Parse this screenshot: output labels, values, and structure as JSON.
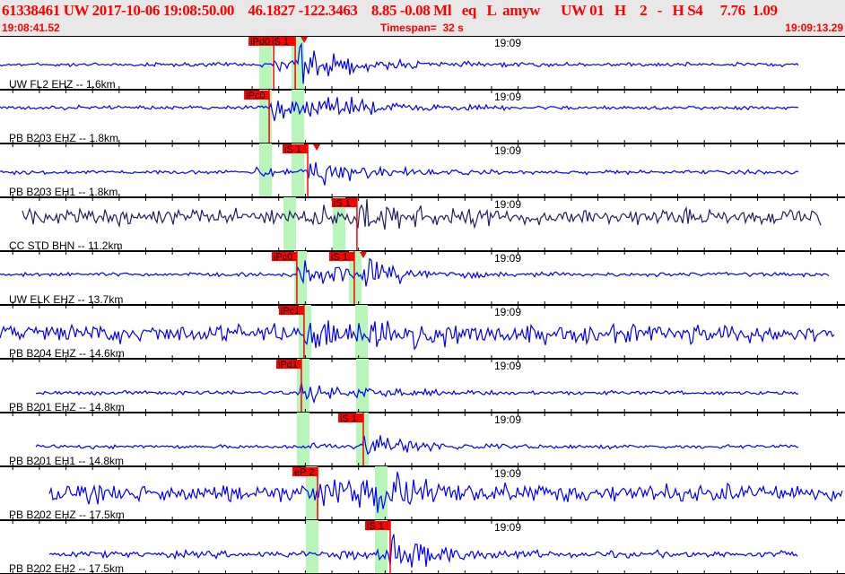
{
  "header": {
    "title": "61338461 UW 2017-10-06 19:08:50.00    46.1827 -122.3463    8.85 -0.08 Ml   eq   L  amyw      UW 01   H    2   -   H S4     7.76  1.09",
    "start_time": "19:08:41.52",
    "timespan_label": "Timespan=",
    "timespan_value": "32 s",
    "end_time": "19:09:13.29"
  },
  "colors": {
    "trace": "#0000ff",
    "trace_broadband": "#202060",
    "pick": "#ff0000",
    "window": "#b8f5b8",
    "header_text": "#ff0000"
  },
  "minute_label": "19:09",
  "channels": [
    {
      "label": "UW FL2 EHZ -- 1.6km",
      "picks": [
        {
          "phase": "iPd0",
          "time": 51.81
        },
        {
          "phase": "iS 1",
          "time": 52.62
        }
      ]
    },
    {
      "label": "PB B203 EHZ -- 1.8km",
      "picks": [
        {
          "phase": "iPc0",
          "time": 51.64
        }
      ]
    },
    {
      "label": "PB B203 EH1 -- 1.8km",
      "picks": [
        {
          "phase": "iS 1",
          "time": 53.09
        }
      ]
    },
    {
      "label": "CC STD BHN -- 11.2km",
      "picks": [
        {
          "phase": "iS 1",
          "time": 54.94
        }
      ]
    },
    {
      "label": "UW ELK EHZ -- 13.7km",
      "picks": [
        {
          "phase": "iPc0",
          "time": 52.68
        },
        {
          "phase": "iS 1",
          "time": 54.84
        }
      ]
    },
    {
      "label": "PB B204 EHZ -- 14.6km",
      "picks": [
        {
          "phase": "iPc1",
          "time": 52.95
        }
      ]
    },
    {
      "label": "PB B201 EHZ -- 14.8km",
      "picks": [
        {
          "phase": "iPd1",
          "time": 52.85
        }
      ]
    },
    {
      "label": "PB B201 EH1 -- 14.8km",
      "picks": [
        {
          "phase": "iS 1",
          "time": 55.18
        }
      ]
    },
    {
      "label": "PB B202 EHZ -- 17.5km",
      "picks": [
        {
          "phase": "eP 2",
          "time": 53.46
        }
      ]
    },
    {
      "label": "PB B202 EH2 -- 17.5km",
      "picks": [
        {
          "phase": "iS 1",
          "time": 56.19
        }
      ]
    }
  ]
}
